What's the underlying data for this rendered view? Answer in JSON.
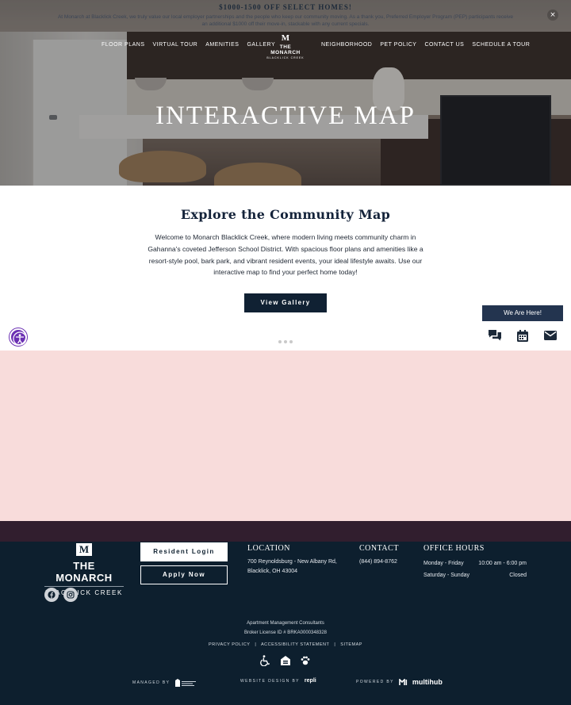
{
  "promo": {
    "title": "$1000-1500 OFF SELECT HOMES!",
    "text": "At Monarch at Blacklick Creek, we truly value our local employer partnerships and the people who keep our community moving. As a thank you, Preferred Employer Program (PEP) participants receive an additional $1000 off their move-in, stackable with any current specials.",
    "close_label": "×"
  },
  "nav": {
    "left_links": [
      "FLOOR PLANS",
      "VIRTUAL TOUR",
      "AMENITIES",
      "GALLERY"
    ],
    "right_links": [
      "NEIGHBORHOOD",
      "PET POLICY",
      "CONTACT US",
      "SCHEDULE A TOUR"
    ],
    "logo": {
      "mark": "M",
      "name": "THE MONARCH",
      "sub": "BLACKLICK CREEK"
    }
  },
  "hero": {
    "title": "INTERACTIVE MAP"
  },
  "intro": {
    "heading": "Explore the Community Map",
    "text": "Welcome to Monarch Blacklick Creek, where modern living meets community charm in Gahanna's coveted Jefferson School District. With spacious floor plans and amenities like a resort-style pool, bark park, and vibrant resident events, your ideal lifestyle awaits. Use our interactive map to find your perfect home today!",
    "button": "View Gallery"
  },
  "widget": {
    "here_label": "We Are Here!",
    "icons": [
      "chat-icon",
      "calendar-icon",
      "mail-icon"
    ]
  },
  "footer": {
    "logo": {
      "mark": "M",
      "name": "THE MONARCH",
      "sub": "BLACKLICK CREEK"
    },
    "resident_login": "Resident Login",
    "apply_now": "Apply Now",
    "location": {
      "heading": "LOCATION",
      "line1": "700 Reynoldsburg - New Albany Rd,",
      "line2": "Blacklick, OH 43004"
    },
    "contact": {
      "heading": "CONTACT",
      "phone": "(844) 894-8762"
    },
    "hours": {
      "heading": "OFFICE HOURS",
      "rows": [
        {
          "days": "Monday - Friday",
          "time": "10:00 am - 6:00 pm"
        },
        {
          "days": "Saturday - Sunday",
          "time": "Closed"
        }
      ]
    },
    "management": "Apartment Management Consultants",
    "broker": "Broker License ID # BRKA0000348328",
    "legal": {
      "privacy": "PRIVACY POLICY",
      "accessibility": "ACCESSIBILITY STATEMENT",
      "sitemap": "SITEMAP",
      "separator": "|"
    },
    "credits": {
      "managed_by": "MANAGED BY",
      "design_by": "WEBSITE DESIGN BY",
      "design_brand": "repli",
      "powered_by": "POWERED BY",
      "powered_brand": "multihub"
    }
  }
}
